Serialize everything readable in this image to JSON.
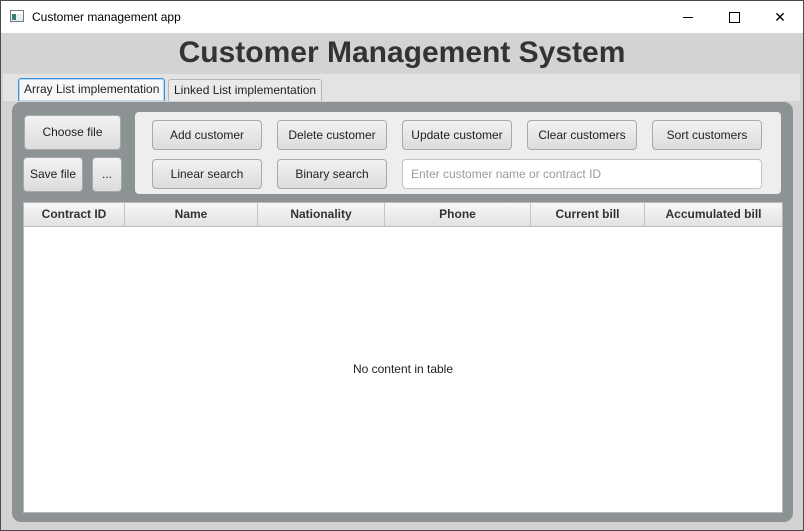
{
  "window": {
    "title": "Customer management app",
    "controls": {
      "minimize": "minimize",
      "maximize": "maximize",
      "close": "✕"
    }
  },
  "header": {
    "title": "Customer Management System"
  },
  "tabs": [
    {
      "label": "Array List implementation",
      "active": true
    },
    {
      "label": "Linked List implementation",
      "active": false
    }
  ],
  "file_actions": {
    "choose_file": "Choose file",
    "save_file": "Save file",
    "more": "..."
  },
  "toolbar": {
    "add": "Add customer",
    "delete": "Delete customer",
    "update": "Update customer",
    "clear": "Clear customers",
    "sort": "Sort customers",
    "linear_search": "Linear search",
    "binary_search": "Binary search",
    "search": {
      "value": "",
      "placeholder": "Enter customer name or contract ID"
    }
  },
  "table": {
    "columns": [
      "Contract ID",
      "Name",
      "Nationality",
      "Phone",
      "Current bill",
      "Accumulated bill"
    ],
    "rows": [],
    "empty_message": "No content in table"
  },
  "colors": {
    "accent": "#3b8edc",
    "panel": "#8d9394",
    "window_bg": "#d3d3d3"
  }
}
